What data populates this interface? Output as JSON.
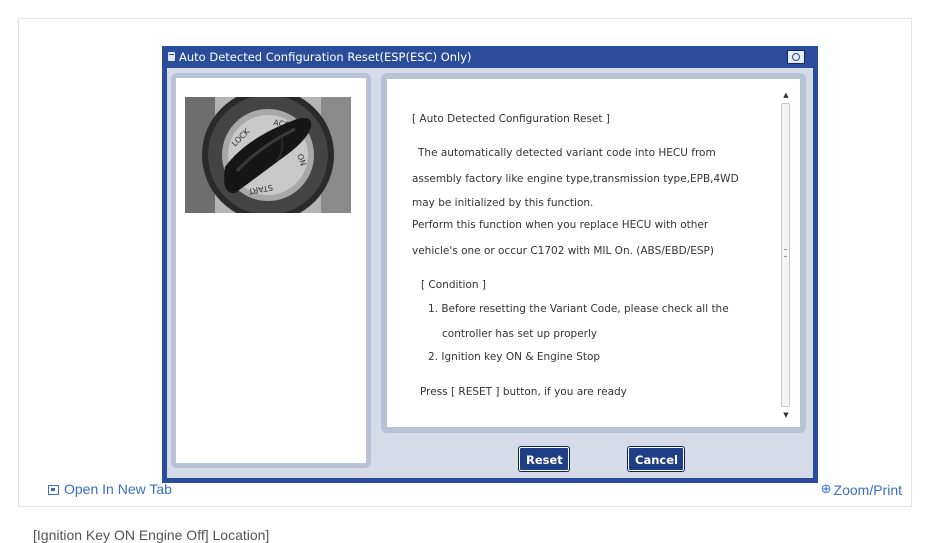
{
  "dialog": {
    "title": "Auto Detected Configuration Reset(ESP(ESC) Only)",
    "icons": {
      "title": "window-icon",
      "capture": "camera-icon"
    }
  },
  "content": {
    "heading": "[ Auto Detected Configuration Reset ]",
    "para1": "The automatically detected variant code into HECU from",
    "para2": "assembly factory like engine type,transmission type,EPB,4WD",
    "para3": "may be initialized by this function.",
    "para4": "Perform this function when you replace HECU with other",
    "para5": "vehicle's one or occur C1702 with MIL On. (ABS/EBD/ESP)",
    "condition_heading": "[ Condition ]",
    "cond1": "1. Before resetting the Variant Code, please check all the",
    "cond1b": "controller has set up properly",
    "cond2": "2. Ignition key ON & Engine Stop",
    "press": "Press [ RESET ] button, if you are ready"
  },
  "photo": {
    "marks": [
      "LOCK",
      "ACC",
      "ON",
      "START"
    ]
  },
  "buttons": {
    "reset": "Reset",
    "cancel": "Cancel"
  },
  "footer": {
    "open_new_tab": "Open In New Tab",
    "zoom_print": "Zoom/Print",
    "icons": {
      "open": "open-in-new-tab-icon",
      "zoom": "zoom-in-icon"
    }
  },
  "caption": "[Ignition Key ON Engine Off] Location]",
  "colors": {
    "dialog_blue": "#2b4c9a",
    "link_blue": "#3a6fc7",
    "button_blue": "#1f3e86"
  }
}
